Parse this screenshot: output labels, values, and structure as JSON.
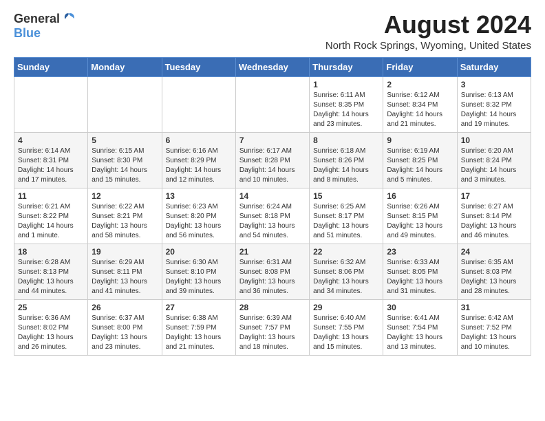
{
  "header": {
    "logo_general": "General",
    "logo_blue": "Blue",
    "title": "August 2024",
    "location": "North Rock Springs, Wyoming, United States"
  },
  "weekdays": [
    "Sunday",
    "Monday",
    "Tuesday",
    "Wednesday",
    "Thursday",
    "Friday",
    "Saturday"
  ],
  "weeks": [
    [
      {
        "day": "",
        "info": ""
      },
      {
        "day": "",
        "info": ""
      },
      {
        "day": "",
        "info": ""
      },
      {
        "day": "",
        "info": ""
      },
      {
        "day": "1",
        "info": "Sunrise: 6:11 AM\nSunset: 8:35 PM\nDaylight: 14 hours\nand 23 minutes."
      },
      {
        "day": "2",
        "info": "Sunrise: 6:12 AM\nSunset: 8:34 PM\nDaylight: 14 hours\nand 21 minutes."
      },
      {
        "day": "3",
        "info": "Sunrise: 6:13 AM\nSunset: 8:32 PM\nDaylight: 14 hours\nand 19 minutes."
      }
    ],
    [
      {
        "day": "4",
        "info": "Sunrise: 6:14 AM\nSunset: 8:31 PM\nDaylight: 14 hours\nand 17 minutes."
      },
      {
        "day": "5",
        "info": "Sunrise: 6:15 AM\nSunset: 8:30 PM\nDaylight: 14 hours\nand 15 minutes."
      },
      {
        "day": "6",
        "info": "Sunrise: 6:16 AM\nSunset: 8:29 PM\nDaylight: 14 hours\nand 12 minutes."
      },
      {
        "day": "7",
        "info": "Sunrise: 6:17 AM\nSunset: 8:28 PM\nDaylight: 14 hours\nand 10 minutes."
      },
      {
        "day": "8",
        "info": "Sunrise: 6:18 AM\nSunset: 8:26 PM\nDaylight: 14 hours\nand 8 minutes."
      },
      {
        "day": "9",
        "info": "Sunrise: 6:19 AM\nSunset: 8:25 PM\nDaylight: 14 hours\nand 5 minutes."
      },
      {
        "day": "10",
        "info": "Sunrise: 6:20 AM\nSunset: 8:24 PM\nDaylight: 14 hours\nand 3 minutes."
      }
    ],
    [
      {
        "day": "11",
        "info": "Sunrise: 6:21 AM\nSunset: 8:22 PM\nDaylight: 14 hours\nand 1 minute."
      },
      {
        "day": "12",
        "info": "Sunrise: 6:22 AM\nSunset: 8:21 PM\nDaylight: 13 hours\nand 58 minutes."
      },
      {
        "day": "13",
        "info": "Sunrise: 6:23 AM\nSunset: 8:20 PM\nDaylight: 13 hours\nand 56 minutes."
      },
      {
        "day": "14",
        "info": "Sunrise: 6:24 AM\nSunset: 8:18 PM\nDaylight: 13 hours\nand 54 minutes."
      },
      {
        "day": "15",
        "info": "Sunrise: 6:25 AM\nSunset: 8:17 PM\nDaylight: 13 hours\nand 51 minutes."
      },
      {
        "day": "16",
        "info": "Sunrise: 6:26 AM\nSunset: 8:15 PM\nDaylight: 13 hours\nand 49 minutes."
      },
      {
        "day": "17",
        "info": "Sunrise: 6:27 AM\nSunset: 8:14 PM\nDaylight: 13 hours\nand 46 minutes."
      }
    ],
    [
      {
        "day": "18",
        "info": "Sunrise: 6:28 AM\nSunset: 8:13 PM\nDaylight: 13 hours\nand 44 minutes."
      },
      {
        "day": "19",
        "info": "Sunrise: 6:29 AM\nSunset: 8:11 PM\nDaylight: 13 hours\nand 41 minutes."
      },
      {
        "day": "20",
        "info": "Sunrise: 6:30 AM\nSunset: 8:10 PM\nDaylight: 13 hours\nand 39 minutes."
      },
      {
        "day": "21",
        "info": "Sunrise: 6:31 AM\nSunset: 8:08 PM\nDaylight: 13 hours\nand 36 minutes."
      },
      {
        "day": "22",
        "info": "Sunrise: 6:32 AM\nSunset: 8:06 PM\nDaylight: 13 hours\nand 34 minutes."
      },
      {
        "day": "23",
        "info": "Sunrise: 6:33 AM\nSunset: 8:05 PM\nDaylight: 13 hours\nand 31 minutes."
      },
      {
        "day": "24",
        "info": "Sunrise: 6:35 AM\nSunset: 8:03 PM\nDaylight: 13 hours\nand 28 minutes."
      }
    ],
    [
      {
        "day": "25",
        "info": "Sunrise: 6:36 AM\nSunset: 8:02 PM\nDaylight: 13 hours\nand 26 minutes."
      },
      {
        "day": "26",
        "info": "Sunrise: 6:37 AM\nSunset: 8:00 PM\nDaylight: 13 hours\nand 23 minutes."
      },
      {
        "day": "27",
        "info": "Sunrise: 6:38 AM\nSunset: 7:59 PM\nDaylight: 13 hours\nand 21 minutes."
      },
      {
        "day": "28",
        "info": "Sunrise: 6:39 AM\nSunset: 7:57 PM\nDaylight: 13 hours\nand 18 minutes."
      },
      {
        "day": "29",
        "info": "Sunrise: 6:40 AM\nSunset: 7:55 PM\nDaylight: 13 hours\nand 15 minutes."
      },
      {
        "day": "30",
        "info": "Sunrise: 6:41 AM\nSunset: 7:54 PM\nDaylight: 13 hours\nand 13 minutes."
      },
      {
        "day": "31",
        "info": "Sunrise: 6:42 AM\nSunset: 7:52 PM\nDaylight: 13 hours\nand 10 minutes."
      }
    ]
  ]
}
